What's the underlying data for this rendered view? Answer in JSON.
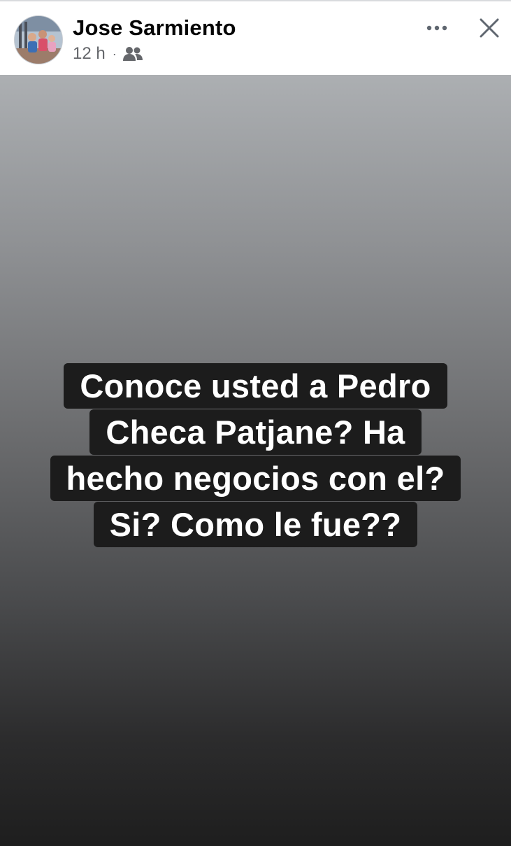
{
  "post": {
    "author": "Jose Sarmiento",
    "time": "12 h",
    "separator": "·",
    "audience_icon": "friends-icon",
    "more_icon": "more-options-icon",
    "close_icon": "close-icon"
  },
  "story": {
    "background_top": "#acafb2",
    "background_bottom": "#1e1e1e",
    "text_box_color": "#1c1c1c",
    "text_color": "#ffffff",
    "lines": [
      "Conoce usted a Pedro",
      "Checa Patjane? Ha",
      "hecho negocios con el?",
      "Si? Como le fue??"
    ]
  }
}
